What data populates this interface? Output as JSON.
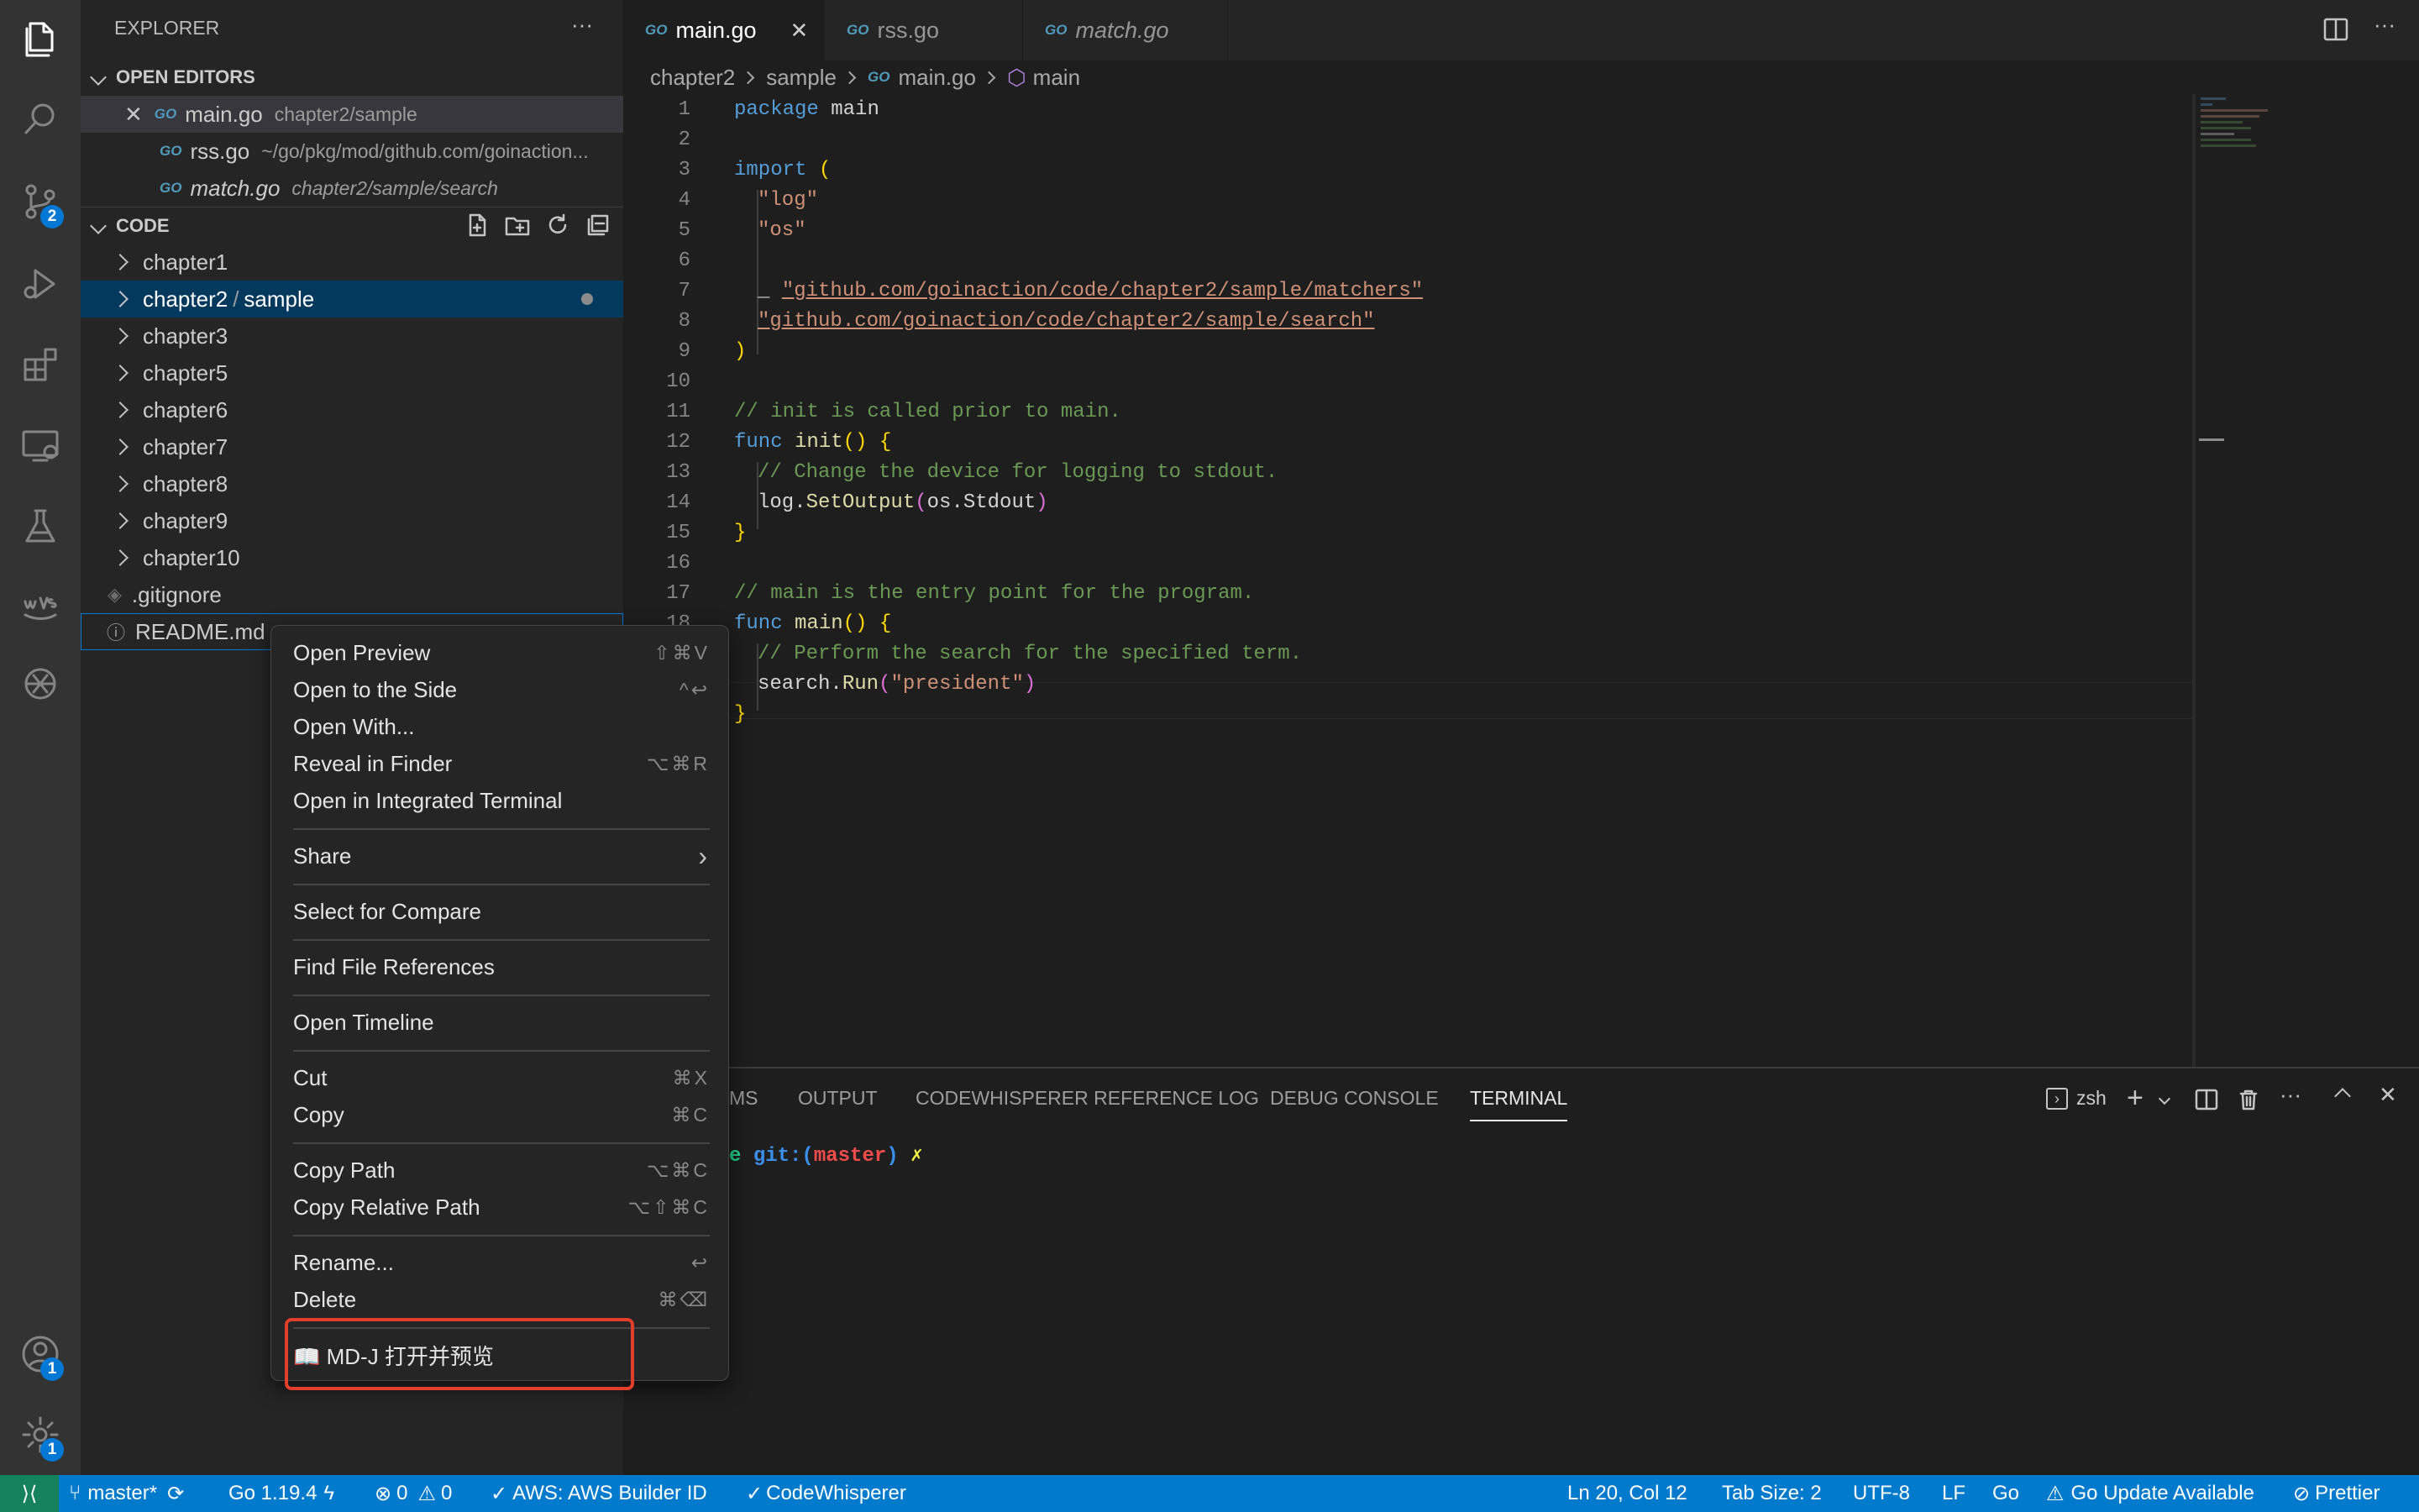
{
  "activity": {
    "scm_badge": "2",
    "accounts_badge": "1",
    "manage_badge": "1"
  },
  "sidebar": {
    "title": "EXPLORER",
    "more": "···",
    "open_editors": {
      "title": "OPEN EDITORS",
      "items": [
        {
          "name": "main.go",
          "desc": "chapter2/sample",
          "icon": "go-file-icon"
        },
        {
          "name": "rss.go",
          "desc": "~/go/pkg/mod/github.com/goinaction...",
          "icon": "go-file-icon"
        },
        {
          "name": "match.go",
          "desc": "chapter2/sample/search",
          "icon": "go-file-icon"
        }
      ]
    },
    "code": {
      "title": "CODE",
      "folders": [
        "chapter1",
        "chapter2",
        "chapter3",
        "chapter5",
        "chapter6",
        "chapter7",
        "chapter8",
        "chapter9",
        "chapter10"
      ],
      "chapter2_sub": "sample",
      "chapter2_sep": "/",
      "files": [
        ".gitignore",
        "README.md"
      ]
    }
  },
  "tabs": [
    {
      "label": "main.go",
      "active": true
    },
    {
      "label": "rss.go",
      "active": false
    },
    {
      "label": "match.go",
      "active": false
    }
  ],
  "go_tag": "GO",
  "breadcrumb": [
    "chapter2",
    "sample",
    "main.go",
    "main"
  ],
  "editor": {
    "line_numbers": [
      "1",
      "2",
      "3",
      "4",
      "5",
      "6",
      "7",
      "8",
      "9",
      "10",
      "11",
      "12",
      "13",
      "14",
      "15",
      "16",
      "17",
      "18"
    ],
    "code": {
      "l1_kw": "package",
      "l1_rest": " main",
      "l3_kw": "import",
      "l3_paren": "(",
      "l4": "\"log\"",
      "l5": "\"os\"",
      "l7_us": "_ ",
      "l7": "\"github.com/goinaction/code/chapter2/sample/matchers\"",
      "l8": "\"github.com/goinaction/code/chapter2/sample/search\"",
      "l9": ")",
      "l11": "// init is called prior to main.",
      "l12_kw": "func",
      "l12_fn": " init",
      "l12_parens": "()",
      "l12_brace": " {",
      "l13": "// Change the device for logging to stdout.",
      "l14_a": "log.",
      "l14_fn": "SetOutput",
      "l14_p1": "(",
      "l14_b": "os.Stdout",
      "l14_p2": ")",
      "l15": "}",
      "l17": "// main is the entry point for the program.",
      "l18_kw": "func",
      "l18_fn": " main",
      "l18_parens": "()",
      "l18_brace": " {",
      "l19": "// Perform the search for the specified term.",
      "l20_a": "search.",
      "l20_fn": "Run",
      "l20_p1": "(",
      "l20_str": "\"president\"",
      "l20_p2": ")",
      "l21": "}"
    }
  },
  "panel": {
    "tabs": [
      "MS",
      "OUTPUT",
      "CODEWHISPERER REFERENCE LOG",
      "DEBUG CONSOLE",
      "TERMINAL"
    ],
    "active_tab": "TERMINAL",
    "shell": "zsh",
    "prompt_dir": "e",
    "prompt_git": "git:(",
    "prompt_branch": "master",
    "prompt_close": ")",
    "prompt_dirty": "✗"
  },
  "context_menu": {
    "groups": [
      [
        {
          "label": "Open Preview",
          "shortcut": "⇧⌘V"
        },
        {
          "label": "Open to the Side",
          "shortcut": "^↩"
        },
        {
          "label": "Open With...",
          "shortcut": ""
        },
        {
          "label": "Reveal in Finder",
          "shortcut": "⌥⌘R"
        },
        {
          "label": "Open in Integrated Terminal",
          "shortcut": ""
        }
      ],
      [
        {
          "label": "Share",
          "shortcut": "›"
        }
      ],
      [
        {
          "label": "Select for Compare",
          "shortcut": ""
        }
      ],
      [
        {
          "label": "Find File References",
          "shortcut": ""
        }
      ],
      [
        {
          "label": "Open Timeline",
          "shortcut": ""
        }
      ],
      [
        {
          "label": "Cut",
          "shortcut": "⌘X"
        },
        {
          "label": "Copy",
          "shortcut": "⌘C"
        }
      ],
      [
        {
          "label": "Copy Path",
          "shortcut": "⌥⌘C"
        },
        {
          "label": "Copy Relative Path",
          "shortcut": "⌥⇧⌘C"
        }
      ],
      [
        {
          "label": "Rename...",
          "shortcut": "↩"
        },
        {
          "label": "Delete",
          "shortcut": "⌘⌫"
        }
      ],
      [
        {
          "label": "📖 MD-J 打开并预览",
          "shortcut": ""
        }
      ]
    ],
    "highlight_color": "#e0402a"
  },
  "status": {
    "branch": "master*",
    "go_version": "Go 1.19.4",
    "errors": "0",
    "warnings": "0",
    "aws": "AWS: AWS Builder ID",
    "codewhisperer": "CodeWhisperer",
    "position": "Ln 20, Col 12",
    "tab_size": "Tab Size: 2",
    "encoding": "UTF-8",
    "eol": "LF",
    "language": "Go",
    "go_update": "Go Update Available",
    "prettier": "Prettier"
  },
  "colors": {
    "accent": "#007acc",
    "selection": "#04395e",
    "badge": "#0078d4"
  }
}
